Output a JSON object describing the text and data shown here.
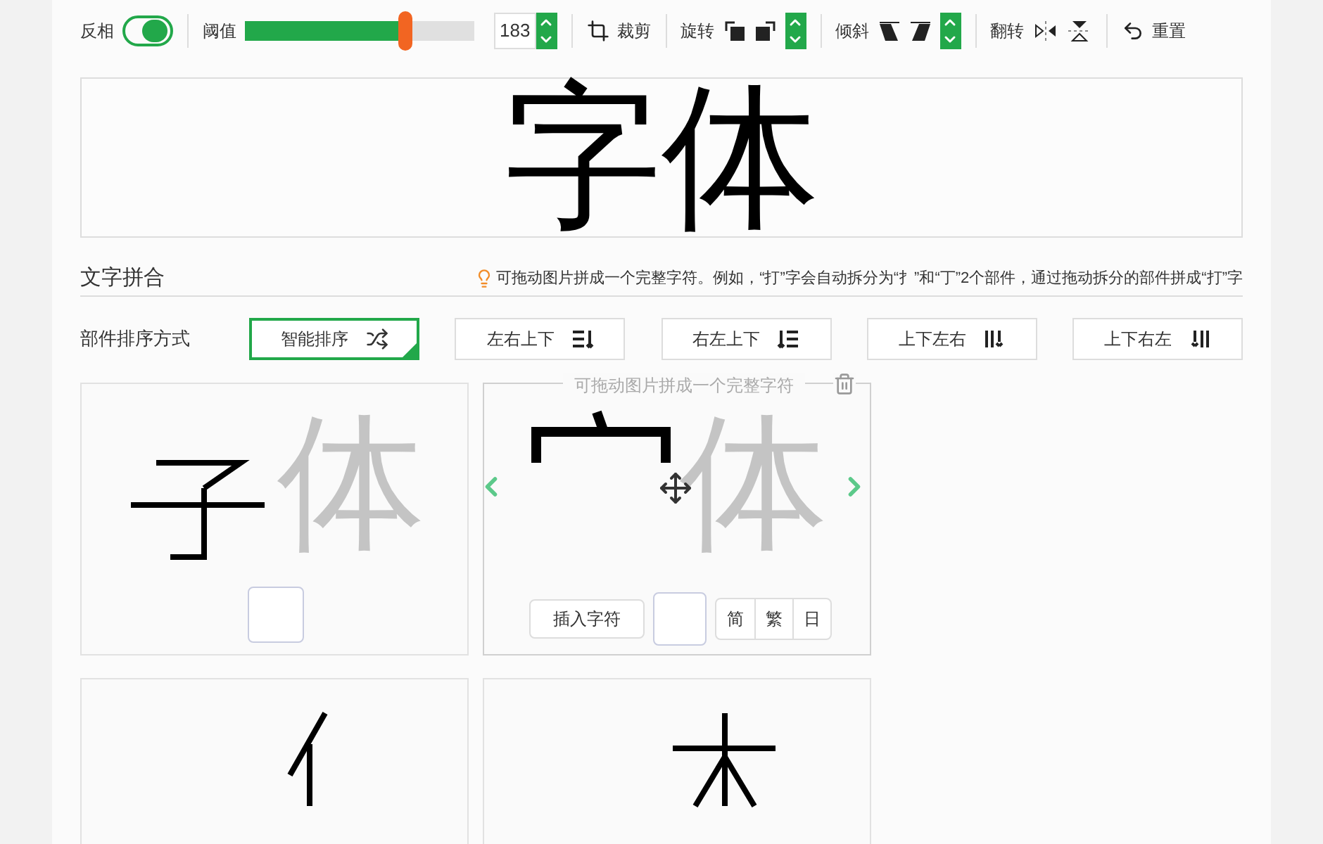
{
  "toolbar": {
    "invert": {
      "label": "反相",
      "on": true
    },
    "threshold": {
      "label": "阈值",
      "level": 0.7,
      "value": "183"
    },
    "crop": "裁剪",
    "rotate": "旋转",
    "skew": "倾斜",
    "flip": "翻转",
    "reset": "重置"
  },
  "preview": {
    "text": "字体"
  },
  "section": {
    "title": "文字拼合",
    "hint": "可拖动图片拼成一个完整字符。例如，“打”字会自动拆分为“扌”和“丁”2个部件，通过拖动拆分的部件拼成“打”字"
  },
  "sort": {
    "label": "部件排序方式",
    "options": [
      {
        "label": "智能排序",
        "kind": "shuffle",
        "selected": true
      },
      {
        "label": "左右上下",
        "kind": "lr",
        "selected": false
      },
      {
        "label": "右左上下",
        "kind": "rl",
        "selected": false
      },
      {
        "label": "上下左右",
        "kind": "tl",
        "selected": false
      },
      {
        "label": "上下右左",
        "kind": "tr",
        "selected": false
      }
    ]
  },
  "tiles": [
    {
      "ghost": "体",
      "kind": "bottom",
      "active": false
    },
    {
      "ghost": "体",
      "kind": "roof",
      "active": true,
      "hint": "可拖动图片拼成一个完整字符",
      "insert": "插入字符",
      "scripts": [
        {
          "label": "简",
          "selected": false
        },
        {
          "label": "繁",
          "selected": false
        },
        {
          "label": "日",
          "selected": false
        }
      ]
    },
    {
      "kind": "person",
      "active": false
    },
    {
      "kind": "tree",
      "active": false
    }
  ]
}
